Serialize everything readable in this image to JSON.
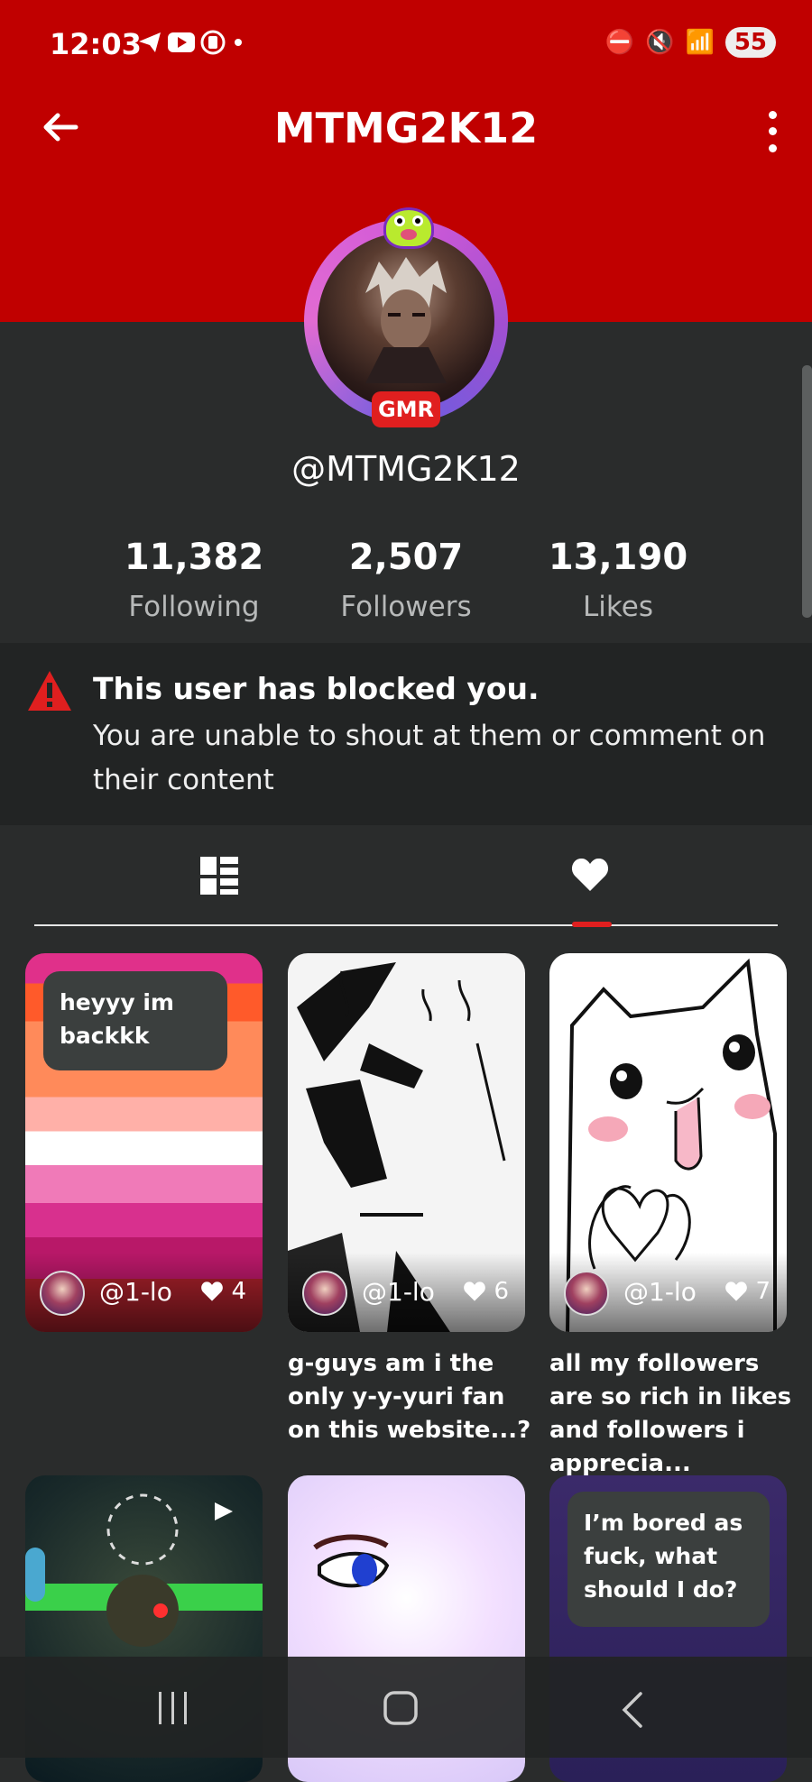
{
  "status_bar": {
    "time": "12:03",
    "left_icons": "◀▶▣⊙ •",
    "battery": "55"
  },
  "header": {
    "title": "MTMG2K12"
  },
  "profile": {
    "badge": "GMR",
    "username": "@MTMG2K12",
    "stats": [
      {
        "value": "11,382",
        "label": "Following"
      },
      {
        "value": "2,507",
        "label": "Followers"
      },
      {
        "value": "13,190",
        "label": "Likes"
      }
    ]
  },
  "blocked_notice": {
    "title": "This user has blocked you.",
    "description": "You are unable to shout at them or comment on their content"
  },
  "tabs": [
    {
      "icon": "grid-icon",
      "active": false
    },
    {
      "icon": "heart-icon",
      "active": true
    }
  ],
  "posts": [
    {
      "bubble_text": "heyyy im backkk",
      "user": "@1-lo",
      "likes": "4",
      "caption": ""
    },
    {
      "bubble_text": "",
      "user": "@1-lo",
      "likes": "6",
      "caption": "g-guys am i the only y-y-yuri fan on this website...?"
    },
    {
      "bubble_text": "",
      "user": "@1-lo",
      "likes": "7",
      "caption": "all my followers are so rich in likes and followers i apprecia..."
    },
    {
      "bubble_text": "",
      "user": "",
      "likes": "",
      "caption": ""
    },
    {
      "bubble_text": "",
      "user": "",
      "likes": "",
      "caption": ""
    },
    {
      "bubble_text": "I’m bored as fuck, what should I do?",
      "user": "",
      "likes": "",
      "caption": ""
    }
  ],
  "colors": {
    "header_red": "#c00000",
    "background": "#2a2c2c",
    "accent_red": "#e01f1f"
  }
}
